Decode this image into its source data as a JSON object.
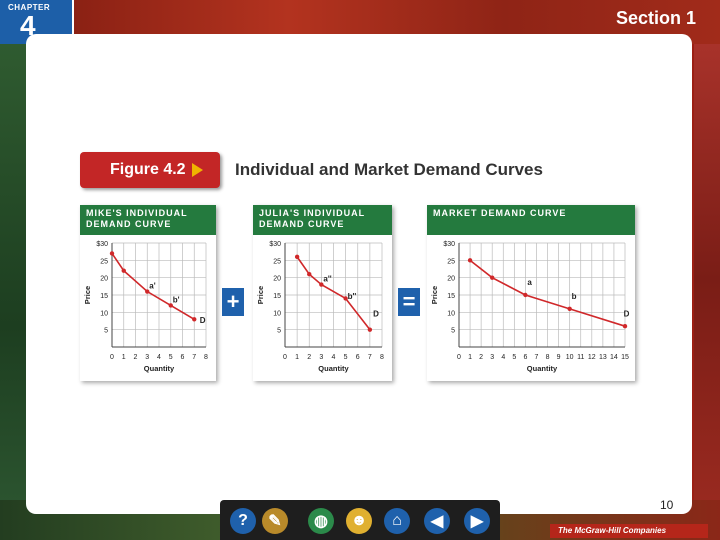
{
  "header": {
    "chapter_label": "CHAPTER",
    "chapter_number": "4",
    "section": "Section 1"
  },
  "figure": {
    "tag": "Figure 4.2",
    "title": "Individual and Market Demand Curves"
  },
  "operators": {
    "plus": "+",
    "equals": "="
  },
  "footer": {
    "page_number": "10",
    "publisher": "The McGraw-Hill Companies"
  },
  "nav": {
    "help": "?",
    "back": "◀",
    "forward": "▶"
  },
  "colors": {
    "curve": "#d0282a",
    "header_green": "#247a3e",
    "accent_blue": "#1f61ac"
  },
  "chart_data": [
    {
      "type": "line",
      "title": "MIKE'S INDIVIDUAL DEMAND CURVE",
      "xlabel": "Quantity",
      "ylabel": "Price",
      "xlim": [
        0,
        8
      ],
      "ylim": [
        0,
        30
      ],
      "xticks": [
        "0",
        "1",
        "2",
        "3",
        "4",
        "5",
        "6",
        "7",
        "8"
      ],
      "yticks": [
        "5",
        "10",
        "15",
        "20",
        "25",
        "$30"
      ],
      "series": [
        {
          "x": [
            0,
            1,
            3,
            5,
            7
          ],
          "y": [
            27,
            22,
            16,
            12,
            8
          ]
        }
      ],
      "annotations": [
        {
          "text": "a'",
          "x": 3,
          "y": 16
        },
        {
          "text": "b'",
          "x": 5,
          "y": 12
        },
        {
          "text": "D",
          "x": 7.3,
          "y": 6
        }
      ]
    },
    {
      "type": "line",
      "title": "JULIA'S INDIVIDUAL DEMAND CURVE",
      "xlabel": "Quantity",
      "ylabel": "Price",
      "xlim": [
        0,
        8
      ],
      "ylim": [
        0,
        30
      ],
      "xticks": [
        "0",
        "1",
        "2",
        "3",
        "4",
        "5",
        "6",
        "7",
        "8"
      ],
      "yticks": [
        "5",
        "10",
        "15",
        "20",
        "25",
        "$30"
      ],
      "series": [
        {
          "x": [
            1,
            2,
            3,
            5,
            7
          ],
          "y": [
            26,
            21,
            18,
            14,
            5
          ]
        }
      ],
      "annotations": [
        {
          "text": "a''",
          "x": 3,
          "y": 18
        },
        {
          "text": "b''",
          "x": 5,
          "y": 13
        },
        {
          "text": "D",
          "x": 7.1,
          "y": 8
        }
      ]
    },
    {
      "type": "line",
      "title": "MARKET DEMAND CURVE",
      "xlabel": "Quantity",
      "ylabel": "Price",
      "xlim": [
        0,
        15
      ],
      "ylim": [
        0,
        30
      ],
      "xticks": [
        "0",
        "1",
        "2",
        "3",
        "4",
        "5",
        "6",
        "7",
        "8",
        "9",
        "10",
        "11",
        "12",
        "13",
        "14",
        "15"
      ],
      "yticks": [
        "5",
        "10",
        "15",
        "20",
        "25",
        "$30"
      ],
      "series": [
        {
          "x": [
            1,
            3,
            6,
            10,
            15
          ],
          "y": [
            25,
            20,
            15,
            11,
            6
          ]
        }
      ],
      "annotations": [
        {
          "text": "a",
          "x": 6,
          "y": 17
        },
        {
          "text": "b",
          "x": 10,
          "y": 13
        },
        {
          "text": "D",
          "x": 14.7,
          "y": 8
        }
      ]
    }
  ]
}
